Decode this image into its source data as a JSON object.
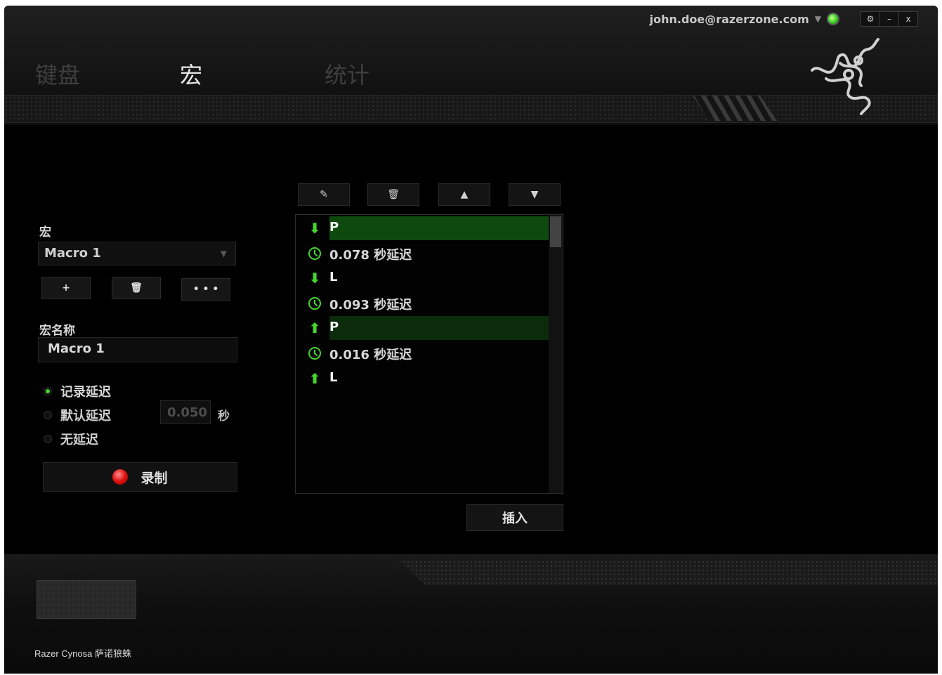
{
  "header": {
    "user_email": "john.doe@razerzone.com",
    "window_buttons": [
      "⚙",
      "–",
      "x"
    ]
  },
  "tabs": [
    {
      "label": "键盘",
      "active": false
    },
    {
      "label": "宏",
      "active": true
    },
    {
      "label": "统计",
      "active": false
    }
  ],
  "macro_panel": {
    "section_label": "宏",
    "selected_macro": "Macro 1",
    "buttons": [
      "+",
      "🗑",
      "• • •"
    ],
    "name_label": "宏名称",
    "name_value": "Macro 1",
    "delay_options": [
      {
        "label": "记录延迟",
        "selected": true
      },
      {
        "label": "默认延迟",
        "selected": false
      },
      {
        "label": "无延迟",
        "selected": false
      }
    ],
    "default_delay_value": "0.050",
    "seconds_label": "秒",
    "record_label": "录制"
  },
  "editor": {
    "toolbar": [
      "✎",
      "🗑",
      "▲",
      "▼"
    ],
    "events": [
      {
        "type": "key-down",
        "text": "P",
        "highlight": "selected"
      },
      {
        "type": "delay",
        "text": "0.078 秒延迟"
      },
      {
        "type": "key-down",
        "text": "L"
      },
      {
        "type": "delay",
        "text": "0.093 秒延迟"
      },
      {
        "type": "key-up",
        "text": "P",
        "highlight": "secondary"
      },
      {
        "type": "delay",
        "text": "0.016 秒延迟"
      },
      {
        "type": "key-up",
        "text": "L"
      }
    ],
    "insert_label": "插入"
  },
  "footer": {
    "device_name": "Razer Cynosa 萨诺狼蛛"
  },
  "colors": {
    "accent": "#44d62c",
    "record": "#e01010",
    "selection": "#0e4a0e"
  }
}
